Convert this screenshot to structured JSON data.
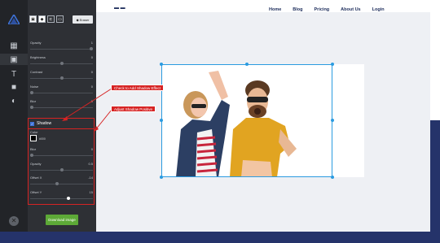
{
  "site": {
    "logo_text": "▬ ▬",
    "nav": [
      "Home",
      "Blog",
      "Pricing",
      "About Us",
      "Login"
    ]
  },
  "rail": {
    "logo_icon": "app-logo-triangle",
    "tools": [
      {
        "name": "layout-icon",
        "glyph": "▦"
      },
      {
        "name": "image-icon",
        "glyph": "▣"
      },
      {
        "name": "text-icon",
        "glyph": "T"
      },
      {
        "name": "background-icon",
        "glyph": "■"
      },
      {
        "name": "adjust-icon",
        "glyph": "◐"
      }
    ],
    "close_glyph": "✕"
  },
  "panel": {
    "toolbar_buttons": [
      "▣",
      "◆",
      "⊏",
      "▭"
    ],
    "erase_label": "Eraser",
    "controls": [
      {
        "label": "Opacity",
        "value": "1",
        "fill": 1.0
      },
      {
        "label": "Brightness",
        "value": "0",
        "fill": 0.5
      },
      {
        "label": "Contrast",
        "value": "0",
        "fill": 0.5
      },
      {
        "label": "Noise",
        "value": "0",
        "fill": 0.0
      },
      {
        "label": "Blur",
        "value": "0",
        "fill": 0.0
      }
    ],
    "shadow": {
      "title": "Shadow",
      "checked": true,
      "color_label": "Color",
      "color_value": "#000000",
      "color_hex": "#000",
      "controls": [
        {
          "label": "Blur",
          "value": "0",
          "fill": 0.0
        },
        {
          "label": "Opacity",
          "value": "0.5",
          "fill": 0.5
        },
        {
          "label": "Offset X",
          "value": "-14",
          "fill": 0.42
        },
        {
          "label": "Offset Y",
          "value": "15",
          "fill": 0.62
        }
      ]
    },
    "download_label": "Download image"
  },
  "annotations": {
    "check_shadow": "Check to Add Shadow Effect",
    "adjust_shadow": "Adjust Shadow Positive"
  },
  "colors": {
    "accent_blue": "#2b9be0",
    "annotation_red": "#d62323",
    "download_green": "#5da937",
    "site_band": "#25336a"
  }
}
